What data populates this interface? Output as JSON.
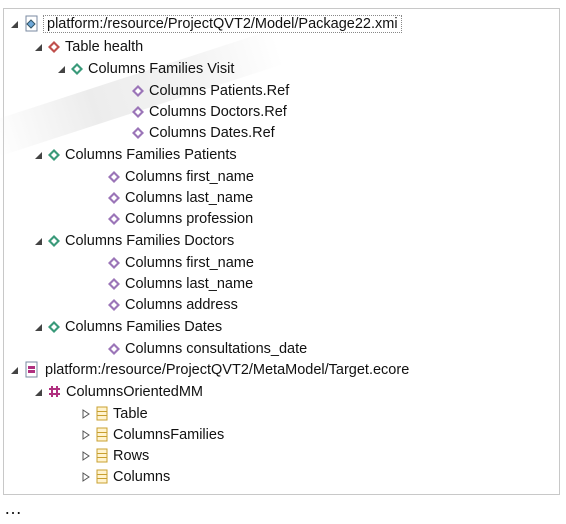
{
  "tree": {
    "root1_label": "platform:/resource/ProjectQVT2/Model/Package22.xmi",
    "table_label": "Table health",
    "visit_label": "Columns Families Visit",
    "visit_children": [
      "Columns Patients.Ref",
      "Columns Doctors.Ref",
      "Columns Dates.Ref"
    ],
    "patients_label": "Columns Families Patients",
    "patients_children": [
      "Columns first_name",
      "Columns last_name",
      "Columns profession"
    ],
    "doctors_label": "Columns Families Doctors",
    "doctors_children": [
      "Columns first_name",
      "Columns last_name",
      "Columns address"
    ],
    "dates_label": "Columns Families Dates",
    "dates_children": [
      "Columns consultations_date"
    ],
    "root2_label": "platform:/resource/ProjectQVT2/MetaModel/Target.ecore",
    "package_label": "ColumnsOrientedMM",
    "classes": [
      "Table",
      "ColumnsFamilies",
      "Rows",
      "Columns"
    ]
  },
  "ellipsis": "…",
  "icons": {
    "expanded_arrow": "expanded-arrow-icon",
    "collapsed_arrow": "collapsed-arrow-icon",
    "xmi_resource": "xmi-file-icon",
    "ecore_resource": "ecore-file-icon",
    "table_object": "red-diamond-icon",
    "family_object": "green-diamond-icon",
    "column_object": "purple-diamond-icon",
    "package": "package-icon",
    "eclass": "eclass-icon"
  },
  "colors": {
    "table_diamond": "#c0504d",
    "family_diamond": "#3a9a7a",
    "column_diamond": "#9b75b8",
    "package": "#b0307f",
    "eclass": "#c8a030"
  }
}
